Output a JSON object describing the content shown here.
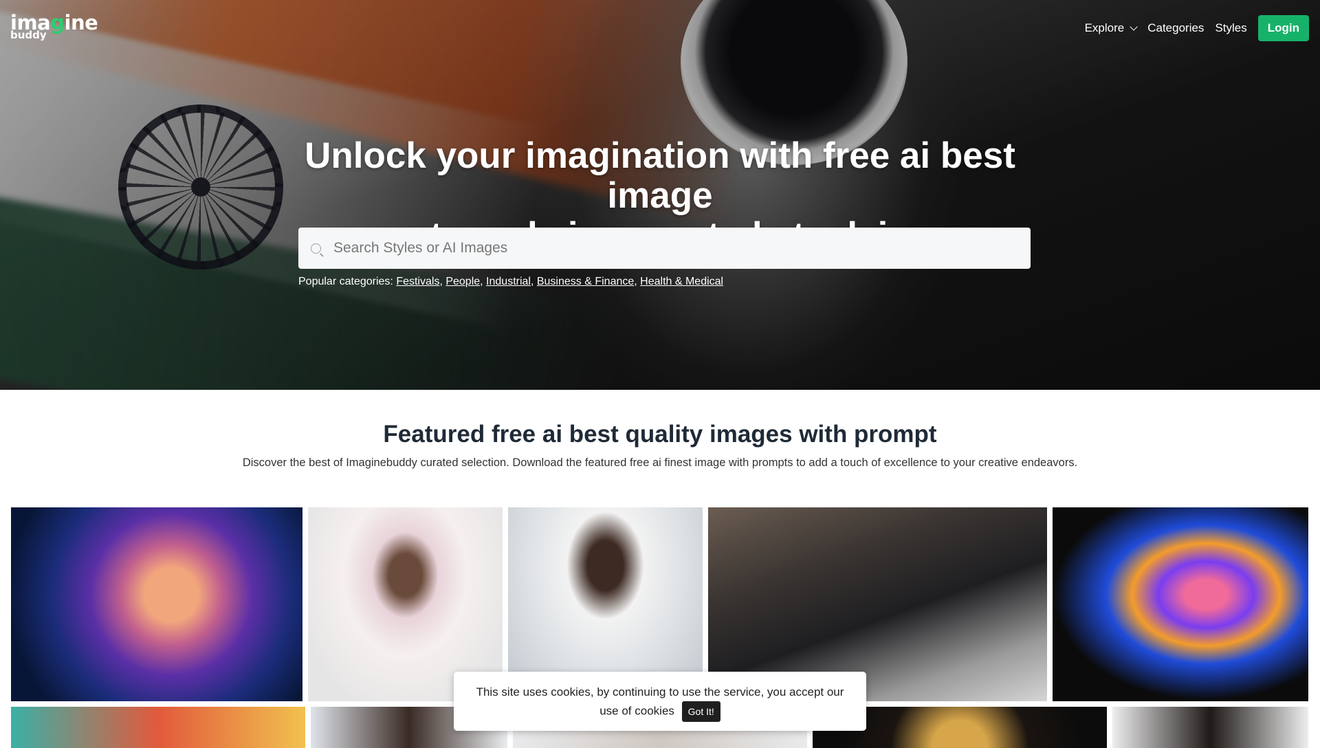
{
  "logo": {
    "main_pre": "ima",
    "main_mark": "g",
    "main_post": "ine",
    "sub": "buddy"
  },
  "nav": {
    "explore": "Explore",
    "categories": "Categories",
    "styles": "Styles",
    "login": "Login"
  },
  "hero": {
    "title_line1": "Unlock your imagination with free ai best image",
    "title_line2": "prompts and ai generated stock images",
    "search_placeholder": "Search Styles or AI Images",
    "popular_label": "Popular categories:",
    "popular": [
      "Festivals",
      "People",
      "Industrial",
      "Business & Finance",
      "Health & Medical"
    ]
  },
  "featured": {
    "title": "Featured free ai best quality images with prompt",
    "subtitle": "Discover the best of Imaginebuddy curated selection. Download the featured free ai finest image with prompts to add a touch of excellence to your creative endeavors."
  },
  "cookie": {
    "line1": "This site uses cookies, by continuing to use the service, you accept our",
    "line2": "use of cookies",
    "button": "Got It!"
  },
  "colors": {
    "accent": "#17b26a",
    "heading": "#1f2a37"
  }
}
